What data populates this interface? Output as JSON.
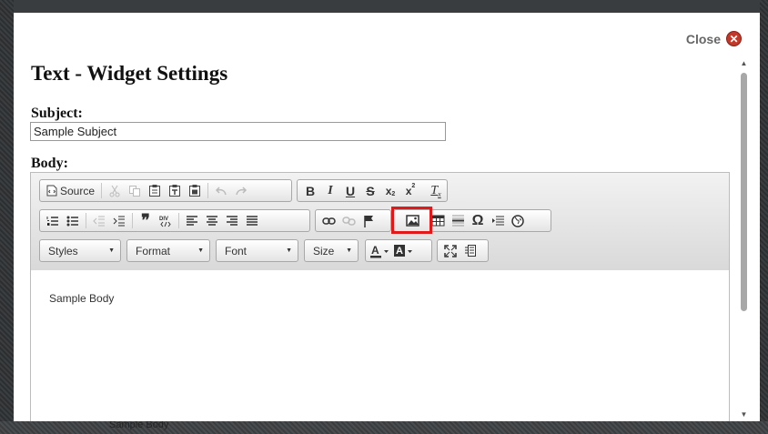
{
  "window": {
    "close_label": "Close",
    "close_icon": "close-icon",
    "accent_close": "#c0392b"
  },
  "page": {
    "title": "Text - Widget Settings"
  },
  "form": {
    "subject_label": "Subject:",
    "subject_value": "Sample Subject",
    "body_label": "Body:"
  },
  "editor": {
    "toolbar_row1": {
      "source_label": "Source",
      "icons": [
        "cut-icon",
        "copy-icon",
        "paste-icon",
        "paste-text-icon",
        "paste-word-icon",
        "undo-icon",
        "redo-icon",
        "bold-icon",
        "italic-icon",
        "underline-icon",
        "strike-icon",
        "subscript-icon",
        "superscript-icon",
        "remove-format-icon"
      ]
    },
    "toolbar_row2": {
      "icons": [
        "numbered-list-icon",
        "bulleted-list-icon",
        "outdent-icon",
        "indent-icon",
        "blockquote-icon",
        "create-div-icon",
        "align-left-icon",
        "align-center-icon",
        "align-right-icon",
        "justify-icon",
        "link-icon",
        "unlink-icon",
        "anchor-icon",
        "image-icon",
        "table-icon",
        "horizontal-line-icon",
        "special-char-icon",
        "page-break-icon",
        "iframe-icon"
      ]
    },
    "toolbar_row3": {
      "styles_label": "Styles",
      "format_label": "Format",
      "font_label": "Font",
      "size_label": "Size",
      "icons": [
        "text-color-icon",
        "background-color-icon",
        "maximize-icon",
        "show-blocks-icon"
      ]
    },
    "highlight_color": "#e01a1a",
    "body_value": "Sample Body"
  },
  "backdrop": {
    "ghost_text": "Sample Body"
  }
}
